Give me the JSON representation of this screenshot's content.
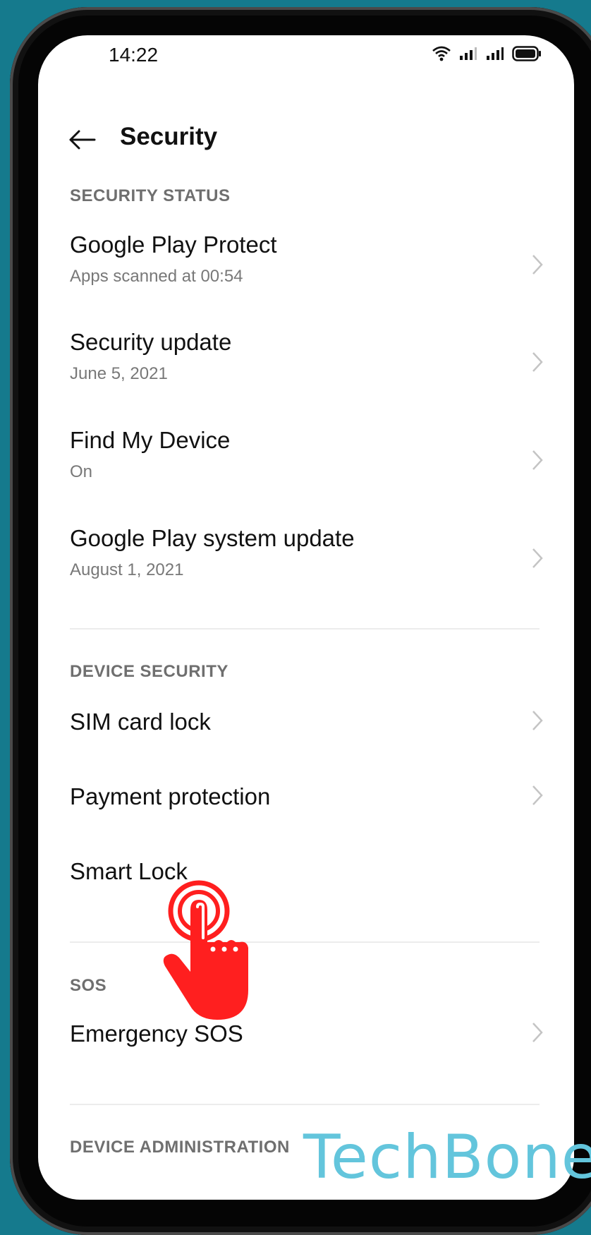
{
  "status_bar": {
    "time": "14:22"
  },
  "header": {
    "title": "Security"
  },
  "sections": {
    "security_status": {
      "label": "SECURITY STATUS",
      "items": [
        {
          "title": "Google Play Protect",
          "subtitle": "Apps scanned at 00:54"
        },
        {
          "title": "Security update",
          "subtitle": "June 5, 2021"
        },
        {
          "title": "Find My Device",
          "subtitle": "On"
        },
        {
          "title": "Google Play system update",
          "subtitle": "August 1, 2021"
        }
      ]
    },
    "device_security": {
      "label": "DEVICE SECURITY",
      "items": [
        {
          "title": "SIM card lock"
        },
        {
          "title": "Payment protection"
        },
        {
          "title": "Smart Lock"
        }
      ]
    },
    "sos": {
      "label": "SOS",
      "items": [
        {
          "title": "Emergency SOS"
        }
      ]
    },
    "device_administration": {
      "label": "DEVICE ADMINISTRATION"
    }
  },
  "watermark": "TechBone",
  "colors": {
    "background": "#157a8d",
    "pointer": "#ff1f1f",
    "watermark": "#63c5dc"
  }
}
